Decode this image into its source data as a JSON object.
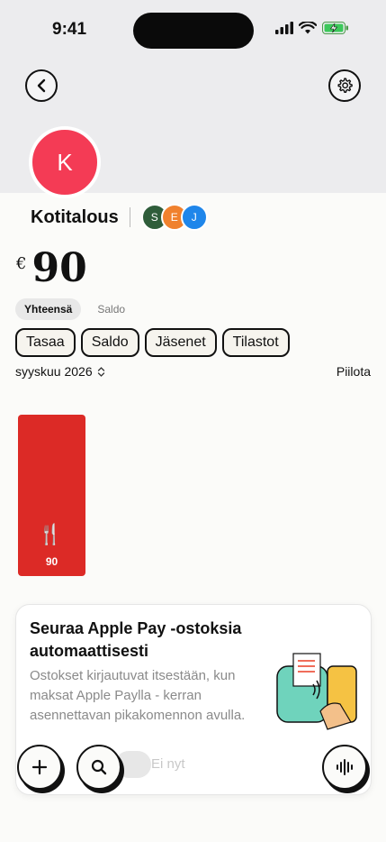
{
  "status_bar": {
    "time": "9:41"
  },
  "header": {
    "back_icon": "chevron-left-icon",
    "settings_icon": "gear-icon"
  },
  "group": {
    "avatar_initial": "K",
    "avatar_color": "#f43b55",
    "name": "Kotitalous",
    "members": [
      {
        "initial": "S",
        "color": "#2f5d3a"
      },
      {
        "initial": "E",
        "color": "#f0812e"
      },
      {
        "initial": "J",
        "color": "#1f86ea"
      }
    ]
  },
  "summary": {
    "currency": "€",
    "amount": "90"
  },
  "view_toggle": {
    "selected": "Yhteensä",
    "other": "Saldo"
  },
  "actions": [
    "Tasaa",
    "Saldo",
    "Jäsenet",
    "Tilastot"
  ],
  "period": {
    "month": "syyskuu 2026",
    "hide_label": "Piilota"
  },
  "chart_data": {
    "type": "bar",
    "categories": [
      "food"
    ],
    "values": [
      90
    ],
    "labels": [
      "90"
    ],
    "colors": [
      "#dc2a26"
    ]
  },
  "promo": {
    "title": "Seuraa Apple Pay -ostoksia automaattisesti",
    "body": "Ostokset kirjautuvat itsestään, kun maksat Apple Paylla - kerran asennettavan pikakomennon avulla.",
    "dismiss_label": "Ei nyt"
  },
  "fabs": {
    "add_icon": "plus-icon",
    "search_icon": "search-icon",
    "voice_icon": "waveform-icon"
  }
}
